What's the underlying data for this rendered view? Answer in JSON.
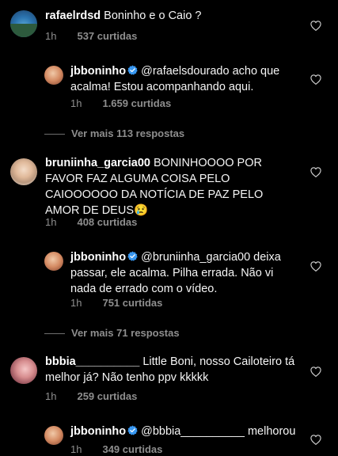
{
  "comments": [
    {
      "username": "rafaelrdsd",
      "text": "Boninho e o Caio ?",
      "time": "1h",
      "likes": "537 curtidas",
      "replies": [
        {
          "username": "jbboninho",
          "verified": true,
          "text": "@rafaelsdourado acho que acalma! Estou acompanhando aqui.",
          "time": "1h",
          "likes": "1.659 curtidas"
        }
      ],
      "view_more": "Ver mais 113 respostas"
    },
    {
      "username": "bruniinha_garcia00",
      "text": "BONINHOOOO POR FAVOR FAZ ALGUMA COISA PELO CAIOOOOOO DA NOTÍCIA DE PAZ PELO AMOR DE DEUS😢",
      "time": "1h",
      "likes": "408 curtidas",
      "replies": [
        {
          "username": "jbboninho",
          "verified": true,
          "text": "@bruniinha_garcia00 deixa passar, ele acalma. Pilha errada. Não vi nada de errado com o vídeo.",
          "time": "1h",
          "likes": "751 curtidas"
        }
      ],
      "view_more": "Ver mais 71 respostas"
    },
    {
      "username": "bbbia__________",
      "text": "Little Boni, nosso Cailoteiro tá melhor já? Não tenho ppv kkkkk",
      "time": "1h",
      "likes": "259 curtidas",
      "replies": [
        {
          "username": "jbboninho",
          "verified": true,
          "text": "@bbbia__________ melhorou",
          "time": "1h",
          "likes": "349 curtidas"
        }
      ]
    }
  ],
  "colors": {
    "background": "#000000",
    "text": "#f5f5f5",
    "muted": "#8e8e8e",
    "verified": "#3897f0"
  },
  "icons": {
    "like": "heart-outline-icon",
    "verified": "verified-badge-icon"
  }
}
